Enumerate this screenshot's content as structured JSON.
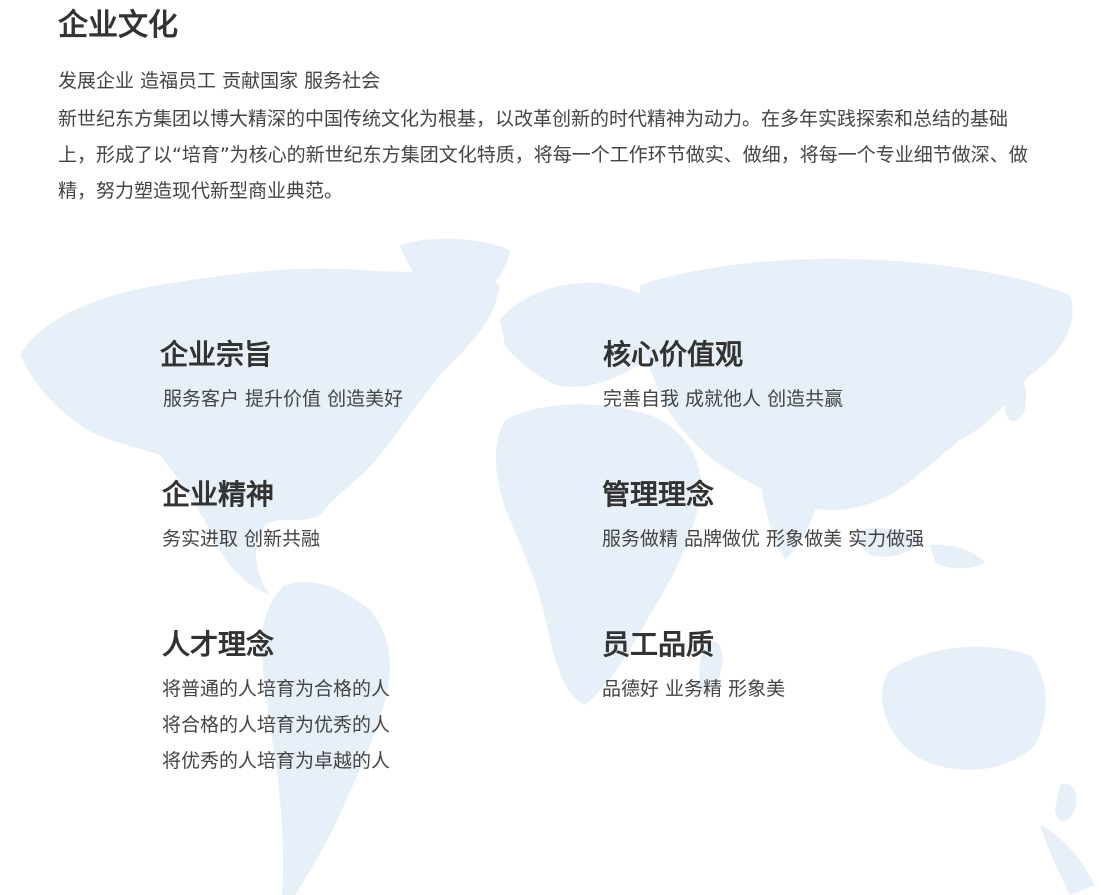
{
  "header": {
    "title": "企业文化",
    "slogan": "发展企业  造福员工  贡献国家  服务社会",
    "intro": "新世纪东方集团以博大精深的中国传统文化为根基，以改革创新的时代精神为动力。在多年实践探索和总结的基础上，形成了以“培育”为核心的新世纪东方集团文化特质，将每一个工作环节做实、做细，将每一个专业细节做深、做精，努力塑造现代新型商业典范。"
  },
  "map": {
    "icon": "world-map-icon",
    "color": "#e3eef8"
  },
  "cards": [
    {
      "title": "企业宗旨",
      "lines": [
        "服务客户  提升价值  创造美好"
      ]
    },
    {
      "title": "核心价值观",
      "lines": [
        "完善自我  成就他人  创造共赢"
      ]
    },
    {
      "title": "企业精神",
      "lines": [
        "务实进取  创新共融"
      ]
    },
    {
      "title": "管理理念",
      "lines": [
        "服务做精 品牌做优 形象做美 实力做强"
      ]
    },
    {
      "title": "人才理念",
      "lines": [
        "将普通的人培育为合格的人",
        "将合格的人培育为优秀的人",
        "将优秀的人培育为卓越的人"
      ]
    },
    {
      "title": "员工品质",
      "lines": [
        "品德好  业务精  形象美"
      ]
    }
  ]
}
